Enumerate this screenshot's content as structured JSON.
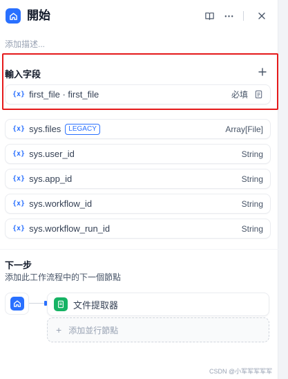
{
  "header": {
    "title": "開始",
    "book_icon": "book-open-icon",
    "more_icon": "more-horizontal-icon",
    "close_icon": "close-icon"
  },
  "description_placeholder": "添加描述...",
  "input_fields": {
    "title": "輸入字段",
    "add_icon": "plus-icon",
    "items": [
      {
        "name": "first_file · first_file",
        "required": "必填",
        "icon": "{x}"
      }
    ]
  },
  "system_vars": [
    {
      "name": "sys.files",
      "badge": "LEGACY",
      "type": "Array[File]",
      "icon": "{x}"
    },
    {
      "name": "sys.user_id",
      "type": "String",
      "icon": "{x}"
    },
    {
      "name": "sys.app_id",
      "type": "String",
      "icon": "{x}"
    },
    {
      "name": "sys.workflow_id",
      "type": "String",
      "icon": "{x}"
    },
    {
      "name": "sys.workflow_run_id",
      "type": "String",
      "icon": "{x}"
    }
  ],
  "next_step": {
    "title": "下一步",
    "description": "添加此工作流程中的下一個節點",
    "next_node_label": "文件提取器",
    "add_parallel_label": "添加並行節點"
  },
  "colors": {
    "accent": "#2970ff",
    "highlight_border": "#e5191a",
    "tool_green": "#16b364"
  },
  "watermark": "CSDN @小军军军军军"
}
